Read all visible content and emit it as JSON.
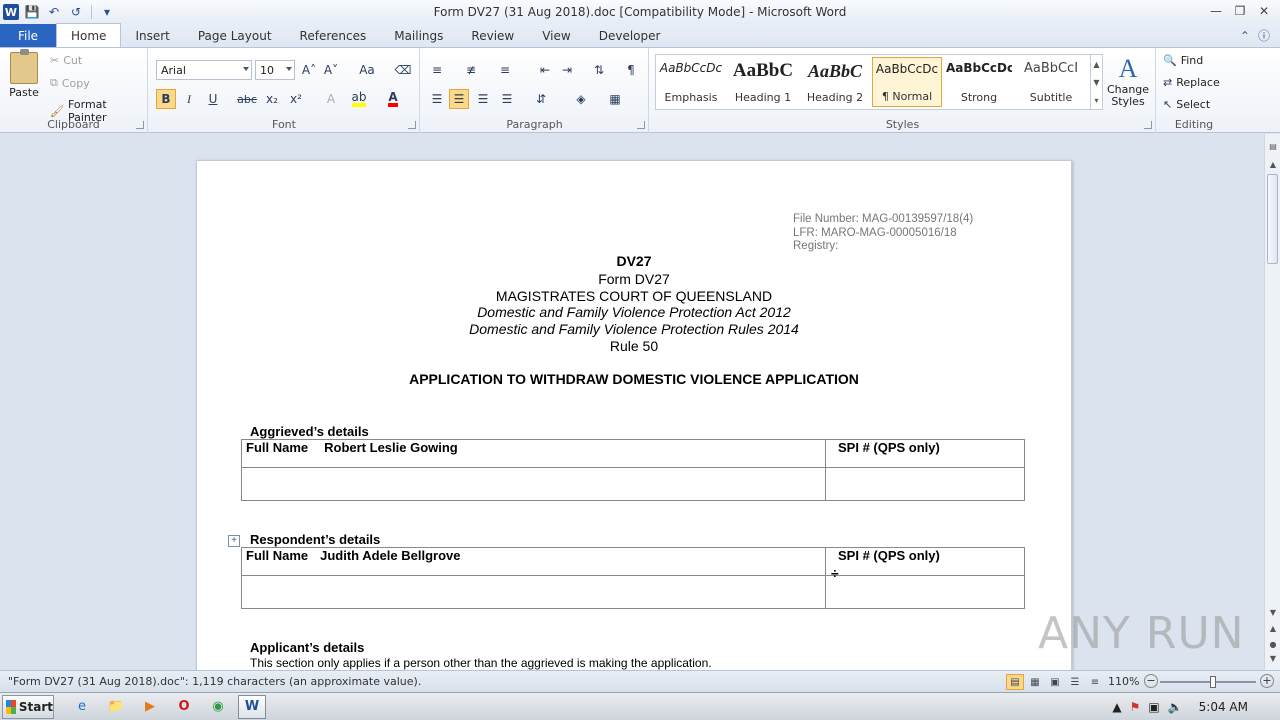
{
  "window": {
    "title": "Form DV27 (31 Aug 2018).doc [Compatibility Mode]  -  Microsoft Word"
  },
  "qat": {
    "word_icon": "W",
    "save_icon": "save-icon",
    "undo_icon": "undo-icon",
    "redo_icon": "redo-icon"
  },
  "tabs": [
    "File",
    "Home",
    "Insert",
    "Page Layout",
    "References",
    "Mailings",
    "Review",
    "View",
    "Developer"
  ],
  "clipboard": {
    "paste": "Paste",
    "cut": "Cut",
    "copy": "Copy",
    "format_painter": "Format Painter",
    "label": "Clipboard"
  },
  "font": {
    "family": "Arial",
    "size": "10",
    "label": "Font",
    "bold": "B",
    "italic": "I",
    "underline": "U",
    "strike": "abc",
    "subscript": "x₂",
    "superscript": "x²",
    "grow": "A˄",
    "shrink": "A˅",
    "case": "Aa",
    "highlight_color": "#ffff00",
    "font_color": "#ff0000"
  },
  "paragraph": {
    "label": "Paragraph",
    "pilcrow": "¶"
  },
  "styles": {
    "label": "Styles",
    "items": [
      {
        "sample": "AaBbCcDc",
        "name": "Emphasis"
      },
      {
        "sample": "AaBbC",
        "name": "Heading 1"
      },
      {
        "sample": "AaBbC",
        "name": "Heading 2"
      },
      {
        "sample": "AaBbCcDc",
        "name": "¶ Normal"
      },
      {
        "sample": "AaBbCcDc",
        "name": "Strong"
      },
      {
        "sample": "AaBbCcI",
        "name": "Subtitle"
      }
    ],
    "change_styles_1": "Change",
    "change_styles_2": "Styles"
  },
  "editing": {
    "label": "Editing",
    "find": "Find",
    "replace": "Replace",
    "select": "Select"
  },
  "document": {
    "file_number": "File Number: MAG-00139597/18(4)",
    "lfr": "LFR: MARO-MAG-00005016/18",
    "registry": "Registry:",
    "form_code": "DV27",
    "form_name": "Form DV27",
    "court": "MAGISTRATES  COURT OF QUEENSLAND",
    "act": "Domestic and Family Violence Protection Act 2012",
    "rules": "Domestic and Family Violence Protection Rules 2014",
    "rule": "Rule 50",
    "heading": "APPLICATION TO WITHDRAW DOMESTIC VIOLENCE APPLICATION",
    "aggrieved": {
      "section": "Aggrieved’s details",
      "full_name_label": "Full Name",
      "full_name": "Robert Leslie Gowing",
      "spi_label": "SPI # (QPS only)"
    },
    "respondent": {
      "section": "Respondent’s details",
      "full_name_label": "Full Name",
      "full_name": "Judith Adele Bellgrove",
      "spi_label": "SPI # (QPS only)"
    },
    "applicant": {
      "section": "Applicant’s details",
      "note": "This  section only applies  if a person  other than the aggrieved  is making the application."
    }
  },
  "watermark": "ANY RUN",
  "status": {
    "message": "\"Form DV27 (31 Aug 2018).doc\": 1,119 characters (an approximate value).",
    "zoom": "110%",
    "zoom_level": 0.55
  },
  "taskbar": {
    "start": "Start",
    "time": "5:04 AM"
  }
}
